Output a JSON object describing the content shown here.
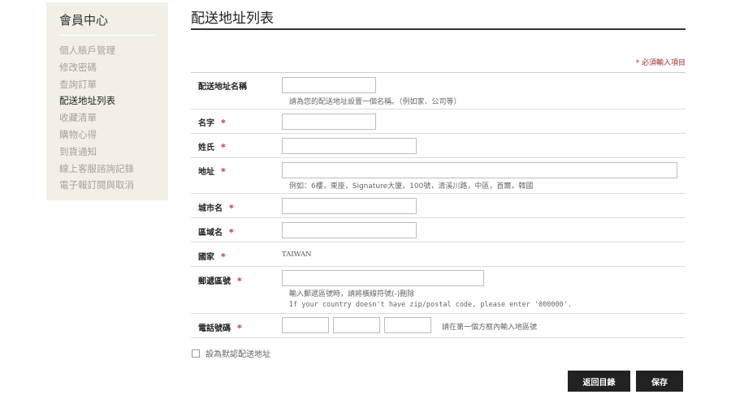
{
  "sidebar": {
    "title": "會員中心",
    "items": [
      {
        "label": "個人賬戶管理"
      },
      {
        "label": "修改密碼"
      },
      {
        "label": "查詢訂單"
      },
      {
        "label": "配送地址列表"
      },
      {
        "label": "收藏清單"
      },
      {
        "label": "購物心得"
      },
      {
        "label": "到貨通知"
      },
      {
        "label": "線上客服諮詢記錄"
      },
      {
        "label": "電子報訂閱與取消"
      }
    ],
    "active_item": "配送地址列表"
  },
  "main": {
    "title": "配送地址列表",
    "required_note": "* 必須輸入項目",
    "required_mark": "*",
    "fields": {
      "address_name": {
        "label": "配送地址名稱",
        "value": "",
        "hint": "請為您的配送地址設置一個名稱。（例如家、公司等）"
      },
      "first_name": {
        "label": "名字",
        "value": ""
      },
      "last_name": {
        "label": "姓氏",
        "value": ""
      },
      "address": {
        "label": "地址",
        "value": "",
        "hint": "例如：6樓，東座，Signature大廈，100號，清溪川路，中區，首爾，韓國"
      },
      "city": {
        "label": "城市名",
        "value": ""
      },
      "region": {
        "label": "區域名",
        "value": ""
      },
      "country": {
        "label": "國家",
        "value": "TAIWAN"
      },
      "postal": {
        "label": "郵遞區號",
        "value": "",
        "hint": "輸入郵遞區號時，請將橫線符號(-)刪除",
        "hint_en": "If your country doesn't have zip/postal code, please enter '000000'."
      },
      "phone": {
        "label": "電話號碼",
        "values": [
          "",
          "",
          ""
        ],
        "hint": "請在第一個方框內輸入地區號"
      }
    },
    "default_checkbox": {
      "label": "設為默認配送地址",
      "checked": false
    },
    "buttons": {
      "back": "返回目錄",
      "save": "保存"
    }
  },
  "colors": {
    "sidebar_bg": "#f2efe6",
    "button_bg": "#222222",
    "required": "#c0252a"
  }
}
